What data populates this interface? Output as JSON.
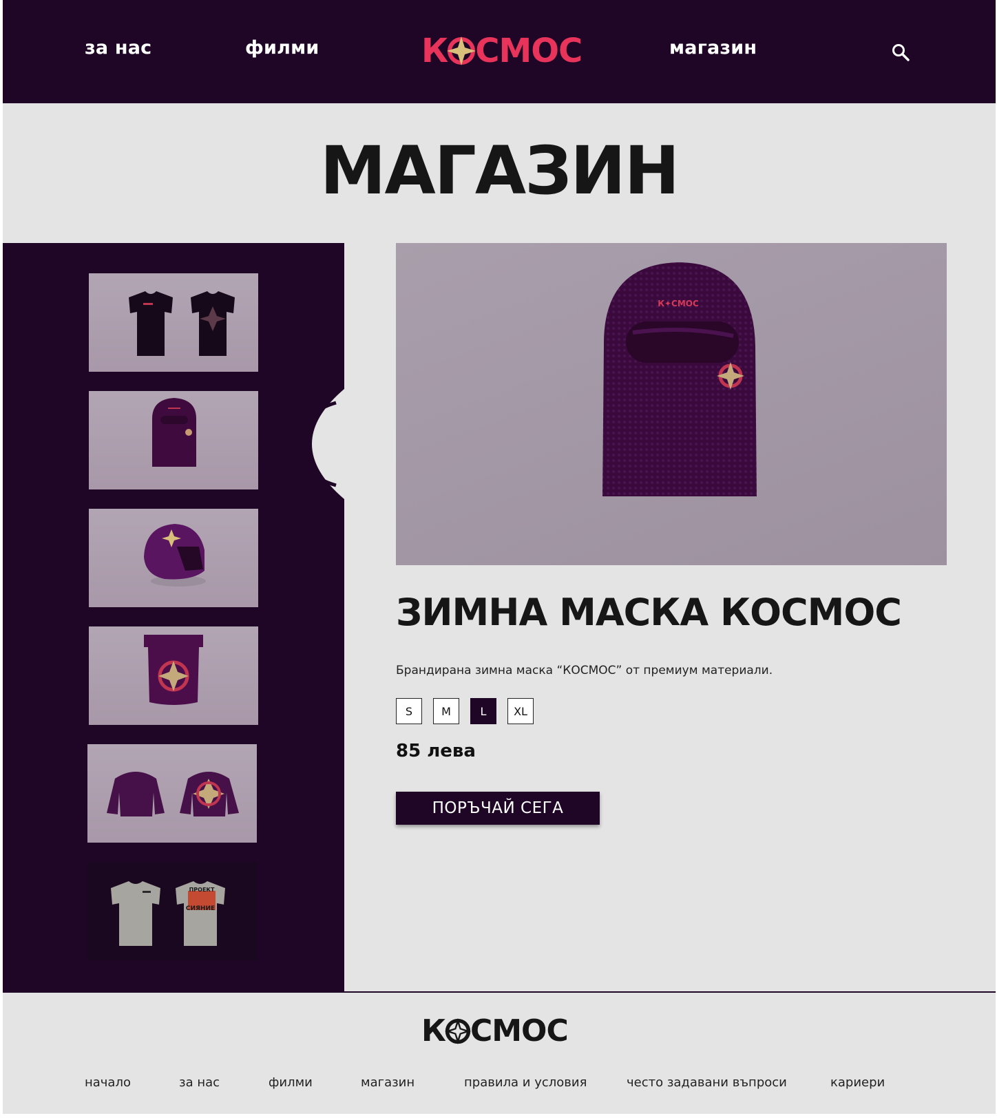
{
  "nav": {
    "about": "за нас",
    "films": "филми",
    "shop": "магазин"
  },
  "brand": {
    "logo_left": "К",
    "logo_right": "СМОС",
    "accent_color": "#e8345b",
    "star_color": "#d8c07a",
    "dark_color": "#1f0626"
  },
  "page": {
    "title": "МАГАЗИН"
  },
  "sidebar": {
    "thumbnails": [
      {
        "icon": "black-tshirts"
      },
      {
        "icon": "purple-balaclava"
      },
      {
        "icon": "purple-helmet"
      },
      {
        "icon": "purple-scarf"
      },
      {
        "icon": "purple-puffer-jackets"
      },
      {
        "icon": "grey-tshirts",
        "print_top": "ПРОЕКТ",
        "print_bottom": "СИЯНИЕ"
      }
    ]
  },
  "product": {
    "print_logo": "К✦СМОС",
    "title": "ЗИМНА МАСКА КОСМОС",
    "description": "Брандирана зимна маска “КОСМОС” от премиум материали.",
    "sizes": [
      "S",
      "M",
      "L",
      "XL"
    ],
    "selected_size": "L",
    "price": "85 лева",
    "order_label": "ПОРЪЧАЙ СЕГА"
  },
  "footer": {
    "links": [
      "начало",
      "за нас",
      "филми",
      "магазин",
      "правила и условия",
      "често задавани въпроси",
      "кариери"
    ]
  }
}
